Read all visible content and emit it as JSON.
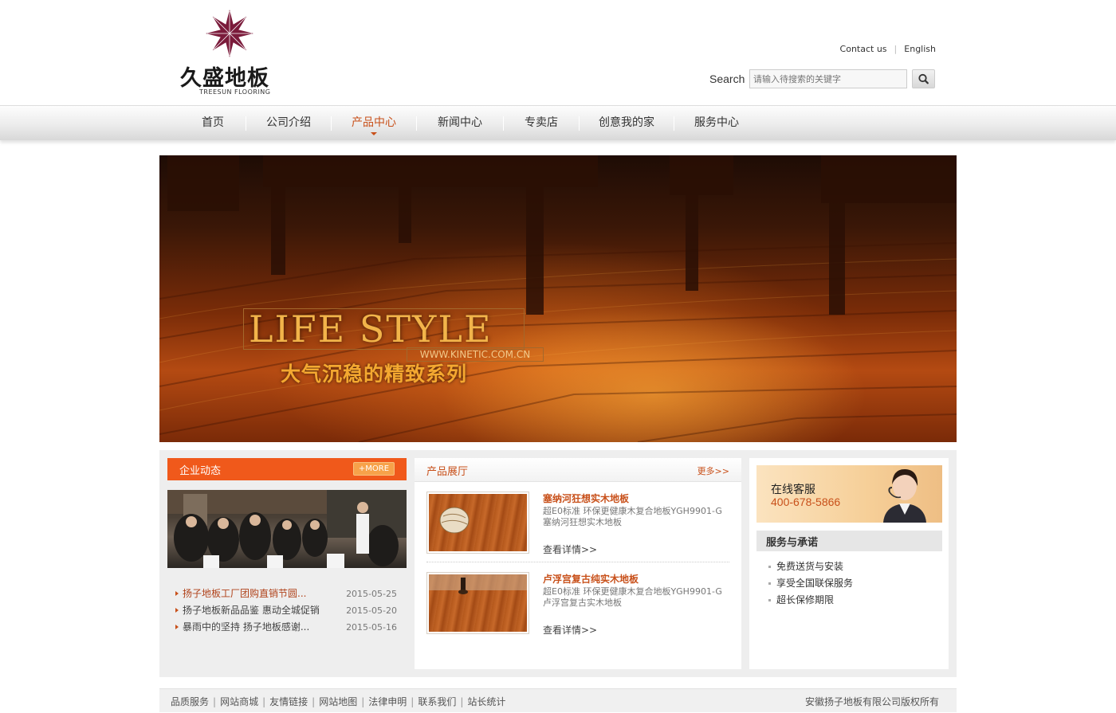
{
  "brand": {
    "name": "久盛地板",
    "sub": "TREESUN FLOORING",
    "logo_color": "#7a1a3a"
  },
  "top_links": {
    "contact": "Contact us",
    "english": "English"
  },
  "search": {
    "label": "Search",
    "placeholder": "请输入待搜索的关键字"
  },
  "nav": {
    "items": [
      {
        "label": "首页"
      },
      {
        "label": "公司介绍"
      },
      {
        "label": "产品中心"
      },
      {
        "label": "新闻中心"
      },
      {
        "label": "专卖店"
      },
      {
        "label": "创意我的家"
      },
      {
        "label": "服务中心"
      }
    ],
    "active": "产品中心"
  },
  "banner": {
    "title": "LIFE STYLE",
    "url": "WWW.KINETIC.COM.CN",
    "subtitle": "大气沉稳的精致系列"
  },
  "news": {
    "title": "企业动态",
    "more": "+MORE",
    "items": [
      {
        "title": "扬子地板工厂团购直销节圆...",
        "date": "2015-05-25"
      },
      {
        "title": "扬子地板新品品鉴 惠动全城促销",
        "date": "2015-05-20"
      },
      {
        "title": "暴雨中的坚持 扬子地板感谢...",
        "date": "2015-05-16"
      }
    ]
  },
  "products": {
    "title": "产品展厅",
    "more": "更多>>",
    "items": [
      {
        "name": "塞纳河狂想实木地板",
        "desc": "超E0标准 环保更健康木复合地板YGH9901-G塞纳河狂想实木地板",
        "link": "查看详情>>"
      },
      {
        "name": "卢浮宫复古纯实木地板",
        "desc": "超E0标准 环保更健康木复合地板YGH9901-G卢浮宫复古实木地板",
        "link": "查看详情>>"
      }
    ]
  },
  "service": {
    "online_label": "在线客服",
    "phone": "400-678-5866",
    "title": "服务与承诺",
    "items": [
      "免费送货与安装",
      "享受全国联保服务",
      "超长保修期限"
    ]
  },
  "footer": {
    "links": [
      "品质服务",
      "网站商城",
      "友情链接",
      "网站地图",
      "法律申明",
      "联系我们",
      "站长统计"
    ],
    "copyright": "安徽扬子地板有限公司版权所有"
  },
  "colors": {
    "accent": "#c8501a",
    "news_header": "#f0591b"
  }
}
